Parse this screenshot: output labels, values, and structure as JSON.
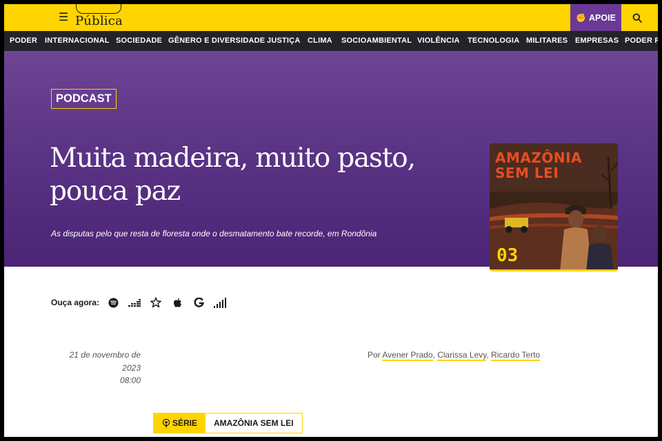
{
  "site": {
    "logo_text": "Pública",
    "menu_icon": "hamburger-menu-icon",
    "apoie_label": "APOIE",
    "apoie_icon": "fist-icon",
    "search_icon": "search-icon",
    "colors": {
      "brand_yellow": "#ffd400",
      "brand_purple": "#6a3996",
      "nav_dark": "#23232a"
    }
  },
  "nav": {
    "items": [
      "PODER",
      "INTERNACIONAL",
      "SOCIEDADE",
      "GÊNERO E DIVERSIDADE",
      "JUSTIÇA",
      "CLIMA",
      "SOCIOAMBIENTAL",
      "VIOLÊNCIA",
      "TECNOLOGIA",
      "MILITARES",
      "EMPRESAS",
      "PODER RI"
    ]
  },
  "hero": {
    "badge": "PODCAST",
    "title_line1": "Muita madeira, muito pasto,",
    "title_line2": "pouca paz",
    "subtitle": "As disputas pelo que resta de floresta onde o desmatamento bate recorde, em Rondônia",
    "cover": {
      "title_line1": "AMAZÔNIA",
      "title_line2": "SEM LEI",
      "episode": "03"
    }
  },
  "listen": {
    "label": "Ouça agora:",
    "platforms": [
      "spotify-icon",
      "deezer-icon",
      "star-icon",
      "apple-icon",
      "google-icon",
      "signal-bars-icon"
    ]
  },
  "meta": {
    "date_line1": "21 de novembro de",
    "date_line2": "2023",
    "time": "08:00",
    "by_label": "Por",
    "authors": [
      "Avener Prado",
      "Clarissa Levy",
      "Ricardo Terto"
    ],
    "separator": ","
  },
  "series": {
    "tag_label": "SÉRIE",
    "tag_icon": "podcast-icon",
    "name": "AMAZÔNIA SEM LEI"
  }
}
